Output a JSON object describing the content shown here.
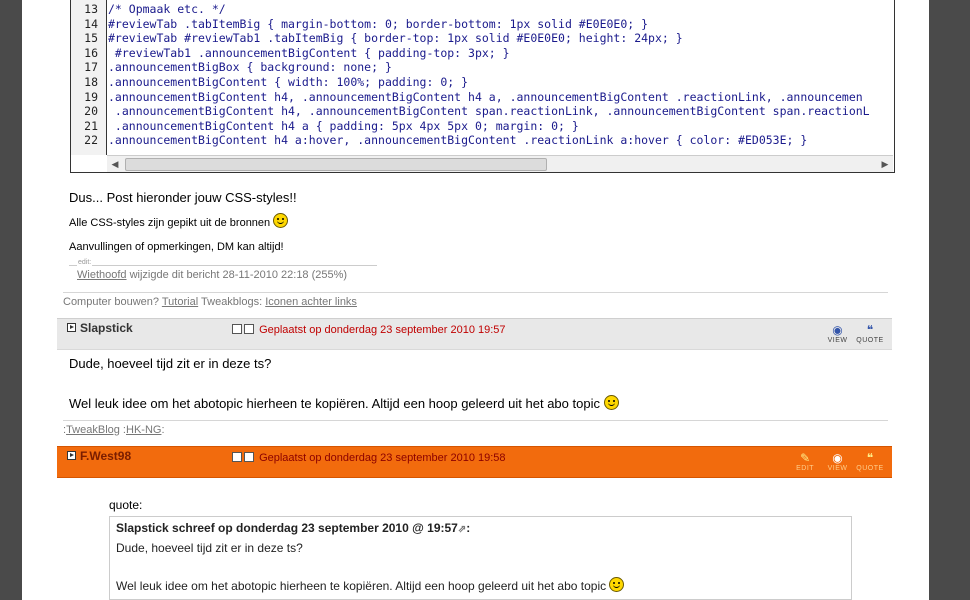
{
  "code": {
    "lines": [
      {
        "n": "13",
        "text": "/* Opmaak etc. */"
      },
      {
        "n": "14",
        "text": "#reviewTab .tabItemBig { margin-bottom: 0; border-bottom: 1px solid #E0E0E0; }"
      },
      {
        "n": "15",
        "text": "#reviewTab #reviewTab1 .tabItemBig { border-top: 1px solid #E0E0E0; height: 24px; }"
      },
      {
        "n": "16",
        "text": " #reviewTab1 .announcementBigContent { padding-top: 3px; }"
      },
      {
        "n": "17",
        "text": ".announcementBigBox { background: none; }"
      },
      {
        "n": "18",
        "text": ".announcementBigContent { width: 100%; padding: 0; }"
      },
      {
        "n": "19",
        "text": ".announcementBigContent h4, .announcementBigContent h4 a, .announcementBigContent .reactionLink, .announcemen"
      },
      {
        "n": "20",
        "text": " .announcementBigContent h4, .announcementBigContent span.reactionLink, .announcementBigContent span.reactionL"
      },
      {
        "n": "21",
        "text": " .announcementBigContent h4 a { padding: 5px 4px 5px 0; margin: 0; }"
      },
      {
        "n": "22",
        "text": ".announcementBigContent h4 a:hover, .announcementBigContent .reactionLink a:hover { color: #ED053E; }"
      }
    ]
  },
  "post1": {
    "line1": "Dus... Post hieronder jouw CSS-styles!!",
    "line2": "Alle CSS-styles zijn gepikt uit de bronnen",
    "line3": "Aanvullingen of opmerkingen, DM kan altijd!",
    "edit_label": "edit:",
    "edit_user": "Wiethoofd",
    "edit_text": " wijzigde dit bericht 28-11-2010 22:18 (255%)",
    "sig_prefix": "Computer bouwen? ",
    "sig_link1": "Tutorial",
    "sig_mid": " Tweakblogs: ",
    "sig_link2": "Iconen achter links"
  },
  "post2": {
    "author": "Slapstick",
    "posted": "Geplaatst op donderdag 23 september 2010 19:57",
    "line1": "Dude, hoeveel tijd zit er in deze ts?",
    "line2": "Wel leuk idee om het abotopic hierheen te kopiëren. Altijd een hoop geleerd uit het abo topic",
    "sig_pre": ":",
    "sig_link1": "TweakBlog",
    "sig_sep": " :",
    "sig_link2": "HK-NG",
    "sig_post": ":",
    "view_label": "VIEW",
    "quote_label": "QUOTE"
  },
  "post3": {
    "author": "F.West98",
    "posted": "Geplaatst op donderdag 23 september 2010 19:58",
    "quote_label_text": "quote:",
    "quote_head": "Slapstick schreef op donderdag 23 september 2010 @ 19:57",
    "quote_line1": "Dude, hoeveel tijd zit er in deze ts?",
    "quote_line2": "Wel leuk idee om het abotopic hierheen te kopiëren. Altijd een hoop geleerd uit het abo topic",
    "edit_label": "EDIT",
    "view_label": "VIEW",
    "quote_label": "QUOTE"
  }
}
